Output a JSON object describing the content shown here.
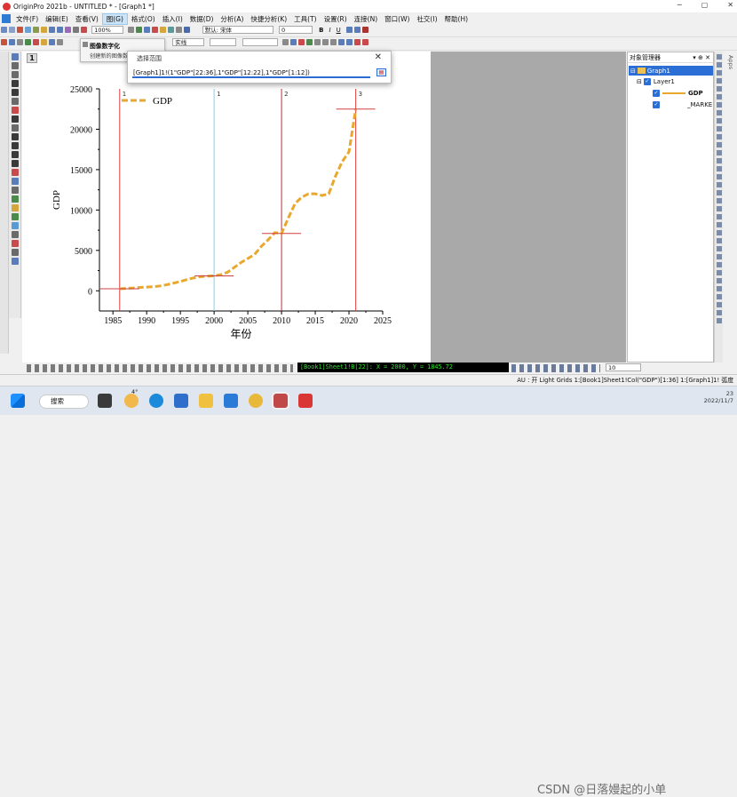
{
  "window": {
    "title": "OriginPro 2021b - UNTITLED * - [Graph1 *]"
  },
  "menu": [
    "文件(F)",
    "编辑(E)",
    "查看(V)",
    "图(G)",
    "格式(O)",
    "插入(I)",
    "数据(D)",
    "分析(A)",
    "快捷分析(K)",
    "工具(T)",
    "设置(R)",
    "连接(N)",
    "窗口(W)",
    "社交(I)",
    "帮助(H)"
  ],
  "toolbar": {
    "zoom": "100%",
    "font": "默认: 宋体",
    "font_size": "0",
    "line_style": "实线"
  },
  "tooltip": {
    "title": "图像数字化",
    "subtitle": "创建新的图像数字化窗口"
  },
  "dialog": {
    "title": "选择范围",
    "value": "[Graph1]1!(1\"GDP\"[22:36],1\"GDP\"[12:22],1\"GDP\"[1:12])"
  },
  "page_number": "1",
  "chart_data": {
    "type": "line",
    "series": [
      {
        "name": "GDP",
        "color": "#e8a82e",
        "x": [
          1986,
          1987,
          1988,
          1989,
          1990,
          1991,
          1992,
          1993,
          1994,
          1995,
          1996,
          1997,
          1998,
          1999,
          2000,
          2001,
          2002,
          2003,
          2004,
          2005,
          2006,
          2007,
          2008,
          2009,
          2010,
          2011,
          2012,
          2013,
          2014,
          2015,
          2016,
          2017,
          2018,
          2019,
          2020,
          2021
        ],
        "values": [
          250,
          300,
          350,
          420,
          450,
          500,
          600,
          750,
          950,
          1150,
          1400,
          1600,
          1750,
          1800,
          1850,
          2000,
          2300,
          2900,
          3500,
          4000,
          4500,
          5500,
          6300,
          7200,
          7100,
          9000,
          10800,
          11600,
          12000,
          12000,
          11800,
          12000,
          14200,
          16000,
          17200,
          22500
        ]
      }
    ],
    "markers": [
      {
        "x": 1986,
        "label": "1",
        "color": "#e04040"
      },
      {
        "x": 2000,
        "label": "1",
        "color": "#7fd4e8"
      },
      {
        "x": 2010,
        "label": "2",
        "color": "#c03030"
      },
      {
        "x": 2021,
        "label": "3",
        "color": "#e04040"
      }
    ],
    "xlabel": "年份",
    "ylabel": "GDP",
    "xlim": [
      1983,
      2025
    ],
    "ylim": [
      -2500,
      25000
    ],
    "xticks": [
      1985,
      1990,
      1995,
      2000,
      2005,
      2010,
      2015,
      2020,
      2025
    ],
    "yticks": [
      0,
      5000,
      10000,
      15000,
      20000,
      25000
    ],
    "grid": false,
    "legend": "top-left"
  },
  "object_manager": {
    "title": "对象管理器",
    "graph": "Graph1",
    "layer": "Layer1",
    "plot": "GDP",
    "marker": "_MARKE"
  },
  "apps_label": "Apps",
  "status_code": "[Book1]Sheet1!B[22]:  X = 2000, Y = 1845.72",
  "status_line": "AU : 开 Light Grids 1:[Book1]Sheet1!Col(\"GDP\")[1:36] 1:[Graph1]1! 弧度",
  "taskbar": {
    "search": "搜索",
    "weather": "4°",
    "time": "23",
    "date": "2022/11/7",
    "watermark": "CSDN @日落嫚起的小单"
  }
}
